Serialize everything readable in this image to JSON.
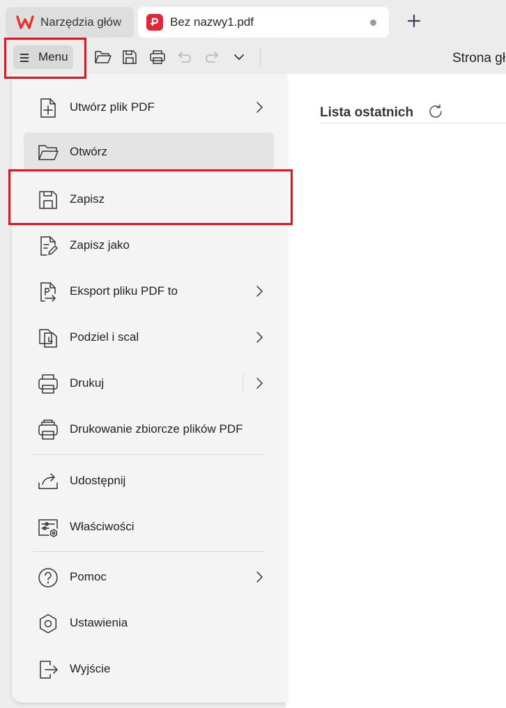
{
  "tabs": [
    {
      "label": "Narzędzia głów",
      "icon": "wps-logo-icon"
    },
    {
      "label": "Bez nazwy1.pdf",
      "icon": "pdf-logo-icon",
      "unsaved": true
    }
  ],
  "toolbar": {
    "menu_label": "Menu",
    "icons": [
      "open-folder-icon",
      "save-icon",
      "print-icon",
      "undo-icon",
      "redo-icon",
      "chevron-down-icon"
    ],
    "page_tab_label": "Strona gł"
  },
  "recent": {
    "title": "Lista ostatnich",
    "icon": "refresh-icon"
  },
  "menu": {
    "items": [
      {
        "label": "Utwórz plik PDF",
        "icon": "create-pdf-icon",
        "submenu": true
      },
      {
        "label": "Otwórz",
        "icon": "open-folder-icon",
        "hovered": true
      },
      {
        "label": "Zapisz",
        "icon": "save-icon",
        "highlighted": true
      },
      {
        "label": "Zapisz jako",
        "icon": "save-as-icon"
      },
      {
        "label": "Eksport pliku PDF to",
        "icon": "export-pdf-icon",
        "submenu": true
      },
      {
        "label": "Podziel i scal",
        "icon": "split-merge-icon",
        "submenu": true
      },
      {
        "label": "Drukuj",
        "icon": "print-icon",
        "submenu": true
      },
      {
        "label": "Drukowanie zbiorcze plików PDF",
        "icon": "batch-print-icon"
      },
      {
        "label": "Udostępnij",
        "icon": "share-icon"
      },
      {
        "label": "Właściwości",
        "icon": "properties-icon"
      },
      {
        "label": "Pomoc",
        "icon": "help-icon",
        "submenu": true
      },
      {
        "label": "Ustawienia",
        "icon": "settings-icon"
      },
      {
        "label": "Wyjście",
        "icon": "exit-icon"
      }
    ]
  },
  "colors": {
    "highlight_box": "#e3121b",
    "pdf_brand": "#e0263b",
    "wps_brand": "#e8302c"
  }
}
